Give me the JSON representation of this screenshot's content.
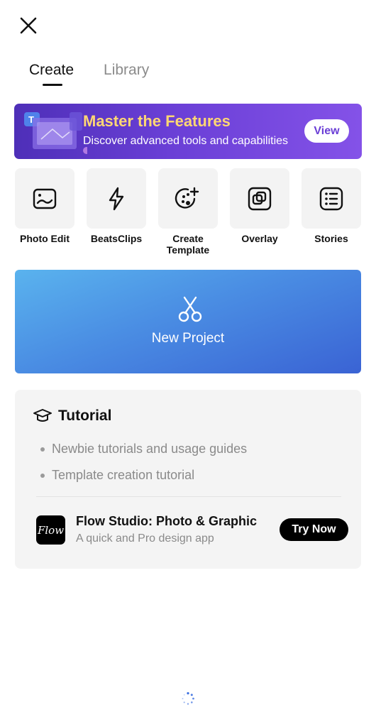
{
  "tabs": [
    {
      "label": "Create",
      "active": true
    },
    {
      "label": "Library",
      "active": false
    }
  ],
  "banner": {
    "title": "Master the Features",
    "subtitle": "Discover advanced tools and capabilities",
    "button": "View",
    "title_color": "#ffd773",
    "gradient": [
      "#4e2fb8",
      "#8452e8"
    ]
  },
  "tools": [
    {
      "label": "Photo Edit",
      "icon": "photo-frame-icon"
    },
    {
      "label": "BeatsClips",
      "icon": "lightning-icon"
    },
    {
      "label": "Create Template",
      "icon": "palette-plus-icon"
    },
    {
      "label": "Overlay",
      "icon": "overlay-squares-icon"
    },
    {
      "label": "Stories",
      "icon": "list-icon"
    }
  ],
  "new_project": {
    "label": "New Project",
    "icon": "scissors-icon",
    "gradient": [
      "#5ab3ee",
      "#3a63d4"
    ]
  },
  "tutorial": {
    "title": "Tutorial",
    "icon": "graduation-cap-icon",
    "items": [
      "Newbie tutorials and usage guides",
      "Template creation tutorial"
    ]
  },
  "promo_app": {
    "logo_text": "Flow",
    "name": "Flow Studio: Photo & Graphic",
    "description": "A quick and Pro design app",
    "button": "Try Now"
  }
}
